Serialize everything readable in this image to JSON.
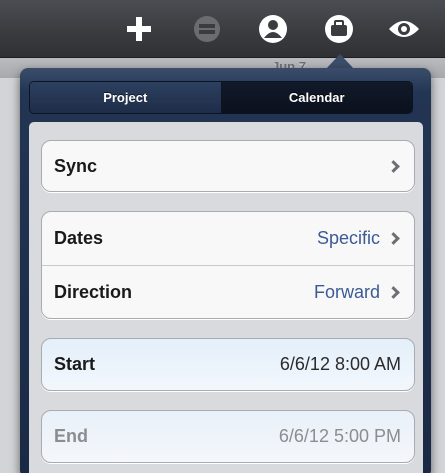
{
  "toolbar": {
    "icons": [
      {
        "name": "add-icon",
        "glyph": "+",
        "enabled": true
      },
      {
        "name": "minus-circle-icon",
        "glyph": "−",
        "enabled": false
      },
      {
        "name": "person-icon",
        "glyph": "",
        "enabled": true
      },
      {
        "name": "briefcase-icon",
        "glyph": "",
        "enabled": true
      },
      {
        "name": "eye-icon",
        "glyph": "",
        "enabled": true
      }
    ]
  },
  "date_label": "Jun 7",
  "segmented": {
    "project_label": "Project",
    "calendar_label": "Calendar",
    "selected": "Project"
  },
  "rows": {
    "sync": {
      "label": "Sync"
    },
    "dates": {
      "label": "Dates",
      "value": "Specific"
    },
    "direction": {
      "label": "Direction",
      "value": "Forward"
    },
    "start": {
      "label": "Start",
      "value": "6/6/12 8:00 AM"
    },
    "end": {
      "label": "End",
      "value": "6/6/12 5:00 PM"
    }
  },
  "colors": {
    "toolbar": "#3a3c40",
    "popover": "#1a2a45",
    "link_value": "#3c5a95"
  }
}
